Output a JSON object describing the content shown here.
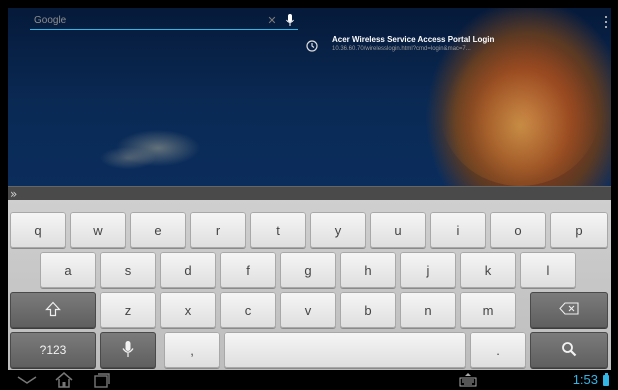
{
  "search": {
    "placeholder": "Google"
  },
  "suggestion": {
    "title": "Acer Wireless Service Access Portal Login",
    "url": "10.36.60.70/wirelesslogin.html?cmd=login&mac=7..."
  },
  "keyboard": {
    "row1": [
      "q",
      "w",
      "e",
      "r",
      "t",
      "y",
      "u",
      "i",
      "o",
      "p"
    ],
    "row2": [
      "a",
      "s",
      "d",
      "f",
      "g",
      "h",
      "j",
      "k",
      "l"
    ],
    "row3": [
      "z",
      "x",
      "c",
      "v",
      "b",
      "n",
      "m"
    ],
    "symbols_label": "?123",
    "comma": ",",
    "period": "."
  },
  "status": {
    "time": "1:53"
  },
  "icons": {
    "expand": "double-chevron-right-icon",
    "shift": "shift-arrow-icon",
    "backspace": "backspace-icon",
    "mic": "microphone-icon",
    "search": "magnifier-icon",
    "clock": "clock-icon"
  },
  "colors": {
    "accent": "#33b5e5",
    "key_light": "#eeeeee",
    "key_dark": "#6a6a6a"
  }
}
